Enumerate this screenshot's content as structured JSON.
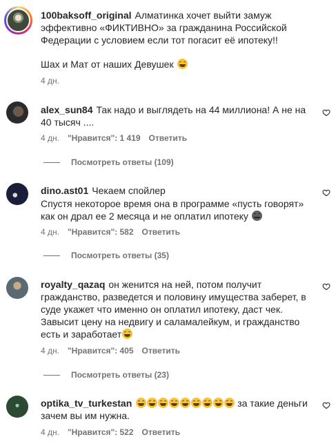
{
  "caption": {
    "username": "100baksoff_original",
    "text": "Алматинка хочет выйти замуж эффективно «ФИКТИВНО» за гражданина Российской Федерации с условием если тот погасит её ипотеку!!",
    "line2": "Шах и Мат от наших Девушек",
    "time": "4 дн."
  },
  "comments": [
    {
      "username": "alex_sun84",
      "text": "Так надо и выглядеть на 44 миллиона! А не на 40 тысяч ....",
      "time": "4 дн.",
      "likes": "\"Нравится\": 1 419",
      "reply": "Ответить",
      "view_replies": "Посмотреть ответы (109)"
    },
    {
      "username": "dino.ast01",
      "text": "Чекаем спойлер",
      "text2": "Спустя некоторое время она в программе «пусть говорят» как он драл ее 2 месяца и не оплатил ипотеку",
      "time": "4 дн.",
      "likes": "\"Нравится\": 582",
      "reply": "Ответить",
      "view_replies": "Посмотреть ответы (35)"
    },
    {
      "username": "royalty_qazaq",
      "text": "он женится на ней, потом получит гражданство, разведется и половину имущества заберет, в суде укажет что именно он оплатил ипотеку, даст чек. Завысит цену на недвигу и саламалейкум, и гражданство есть и заработает",
      "time": "4 дн.",
      "likes": "\"Нравится\": 405",
      "reply": "Ответить",
      "view_replies": "Посмотреть ответы (23)"
    },
    {
      "username": "optika_tv_turkestan",
      "text": "за такие деньги зачем вы им нужна.",
      "time": "4 дн.",
      "likes": "\"Нравится\": 522",
      "reply": "Ответить"
    }
  ],
  "colors": {
    "text": "#262626",
    "secondary": "#737373",
    "emoji": "#f7c332"
  },
  "icons": {
    "like": "heart-outline-icon",
    "laugh": "grinning-face-emoji",
    "unamused": "grey-face-emoji"
  }
}
